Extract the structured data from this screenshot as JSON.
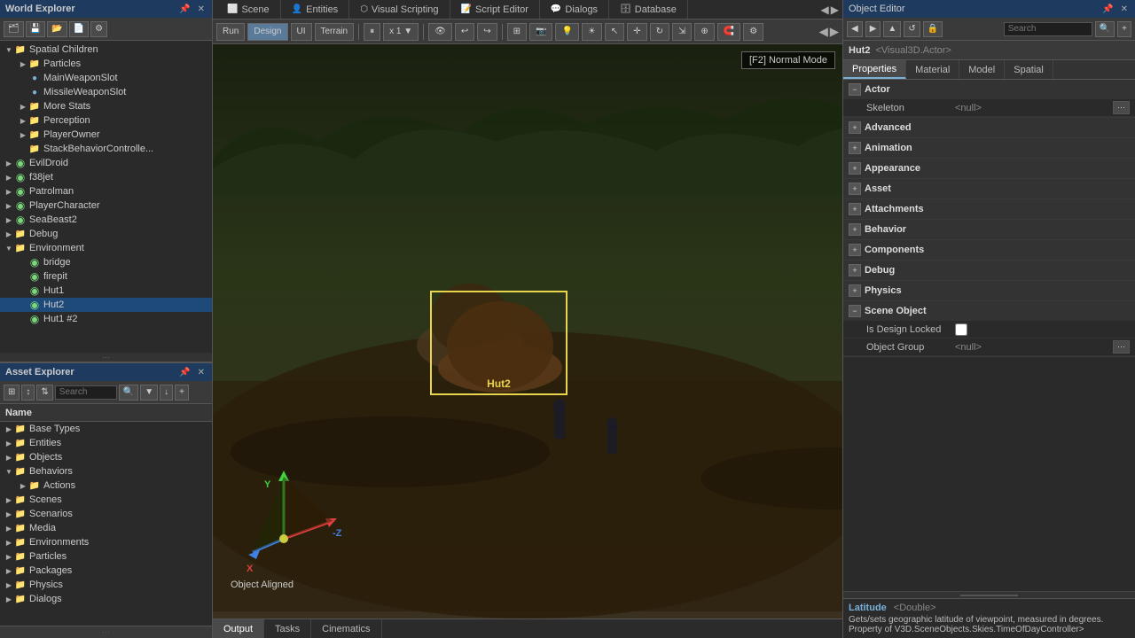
{
  "worldExplorer": {
    "title": "World Explorer",
    "tree": [
      {
        "id": "spatial-children",
        "label": "Spatial Children",
        "level": 0,
        "type": "folder",
        "expanded": true
      },
      {
        "id": "particles",
        "label": "Particles",
        "level": 1,
        "type": "folder",
        "expanded": false
      },
      {
        "id": "main-weapon-slot",
        "label": "MainWeaponSlot",
        "level": 1,
        "type": "node"
      },
      {
        "id": "missile-weapon-slot",
        "label": "MissileWeaponSlot",
        "level": 1,
        "type": "node"
      },
      {
        "id": "more-stats",
        "label": "More Stats",
        "level": 1,
        "type": "folder"
      },
      {
        "id": "perception",
        "label": "Perception",
        "level": 1,
        "type": "folder"
      },
      {
        "id": "player-owner",
        "label": "PlayerOwner",
        "level": 1,
        "type": "folder"
      },
      {
        "id": "stack-behavior",
        "label": "StackBehaviorControlle...",
        "level": 1,
        "type": "folder"
      },
      {
        "id": "evil-droid",
        "label": "EvilDroid",
        "level": 0,
        "type": "node-g"
      },
      {
        "id": "f38jet",
        "label": "f38jet",
        "level": 0,
        "type": "node-g"
      },
      {
        "id": "patrolman",
        "label": "Patrolman",
        "level": 0,
        "type": "node-g"
      },
      {
        "id": "player-character",
        "label": "PlayerCharacter",
        "level": 0,
        "type": "node-g"
      },
      {
        "id": "sea-beast2",
        "label": "SeaBeast2",
        "level": 0,
        "type": "node-g"
      },
      {
        "id": "debug",
        "label": "Debug",
        "level": 0,
        "type": "folder",
        "expanded": true
      },
      {
        "id": "environment",
        "label": "Environment",
        "level": 0,
        "type": "folder",
        "expanded": true
      },
      {
        "id": "bridge",
        "label": "bridge",
        "level": 1,
        "type": "node-g"
      },
      {
        "id": "firepit",
        "label": "firepit",
        "level": 1,
        "type": "node-g"
      },
      {
        "id": "hut1",
        "label": "Hut1",
        "level": 1,
        "type": "node-g"
      },
      {
        "id": "hut2",
        "label": "Hut2",
        "level": 1,
        "type": "node-g",
        "selected": true
      },
      {
        "id": "hut1-2",
        "label": "Hut1 #2",
        "level": 1,
        "type": "node-g"
      }
    ]
  },
  "assetExplorer": {
    "title": "Asset Explorer",
    "searchPlaceholder": "Search",
    "columnHeader": "Name",
    "tree": [
      {
        "id": "base-types",
        "label": "Base Types",
        "level": 0,
        "type": "folder"
      },
      {
        "id": "entities",
        "label": "Entities",
        "level": 0,
        "type": "folder"
      },
      {
        "id": "objects",
        "label": "Objects",
        "level": 0,
        "type": "folder"
      },
      {
        "id": "behaviors",
        "label": "Behaviors",
        "level": 0,
        "type": "folder",
        "expanded": true
      },
      {
        "id": "actions",
        "label": "Actions",
        "level": 1,
        "type": "folder"
      },
      {
        "id": "scenes",
        "label": "Scenes",
        "level": 0,
        "type": "folder"
      },
      {
        "id": "scenarios",
        "label": "Scenarios",
        "level": 0,
        "type": "folder"
      },
      {
        "id": "media",
        "label": "Media",
        "level": 0,
        "type": "folder"
      },
      {
        "id": "environments",
        "label": "Environments",
        "level": 0,
        "type": "folder"
      },
      {
        "id": "particles",
        "label": "Particles",
        "level": 0,
        "type": "folder"
      },
      {
        "id": "packages",
        "label": "Packages",
        "level": 0,
        "type": "folder"
      },
      {
        "id": "physics",
        "label": "Physics",
        "level": 0,
        "type": "folder"
      },
      {
        "id": "dialogs",
        "label": "Dialogs",
        "level": 0,
        "type": "folder"
      }
    ]
  },
  "sceneToolbar": {
    "tabs": [
      "Scene",
      "Entities",
      "Visual Scripting",
      "Script Editor",
      "Dialogs",
      "Database"
    ],
    "activeTab": "Scene"
  },
  "viewportToolbar": {
    "playBtn": "Run",
    "designBtn": "Design",
    "uiBtn": "UI",
    "terrainBtn": "Terrain",
    "speedLabel": "x 1",
    "hudLabel": "[F2] Normal Mode"
  },
  "viewport": {
    "selectedObject": "Hut2",
    "axisX": "X",
    "axisY": "Y",
    "axisNegZ": "-Z",
    "alignLabel": "Object Aligned"
  },
  "bottomTabs": {
    "tabs": [
      "Output",
      "Tasks",
      "Cinematics"
    ],
    "activeTab": "Output"
  },
  "objectEditor": {
    "title": "Object Editor",
    "objectName": "Hut2",
    "objectType": "<Visual3D.Actor>",
    "tabs": [
      "Properties",
      "Material",
      "Model",
      "Spatial"
    ],
    "activeTab": "Properties",
    "searchPlaceholder": "Search",
    "sections": [
      {
        "id": "actor",
        "label": "Actor",
        "expanded": true,
        "rows": [
          {
            "key": "Skeleton",
            "value": "<null>",
            "hasBtn": true
          }
        ]
      },
      {
        "id": "advanced",
        "label": "Advanced",
        "expanded": false,
        "rows": []
      },
      {
        "id": "animation",
        "label": "Animation",
        "expanded": false,
        "rows": []
      },
      {
        "id": "appearance",
        "label": "Appearance",
        "expanded": false,
        "rows": []
      },
      {
        "id": "asset",
        "label": "Asset",
        "expanded": false,
        "rows": []
      },
      {
        "id": "attachments",
        "label": "Attachments",
        "expanded": false,
        "rows": []
      },
      {
        "id": "behavior",
        "label": "Behavior",
        "expanded": false,
        "rows": []
      },
      {
        "id": "components",
        "label": "Components",
        "expanded": false,
        "rows": []
      },
      {
        "id": "debug",
        "label": "Debug",
        "expanded": false,
        "rows": []
      },
      {
        "id": "physics",
        "label": "Physics",
        "expanded": false,
        "rows": []
      },
      {
        "id": "scene-object",
        "label": "Scene Object",
        "expanded": true,
        "rows": [
          {
            "key": "Is Design Locked",
            "value": "",
            "isCheckbox": true
          },
          {
            "key": "Object Group",
            "value": "<null>",
            "hasBtn": true
          }
        ]
      }
    ],
    "statusKey": "Latitude",
    "statusType": "<Double>",
    "statusDesc": "Gets/sets geographic latitude of viewpoint, measured in degrees. Property of V3D.SceneObjects.Skies.TimeOfDayController>"
  }
}
